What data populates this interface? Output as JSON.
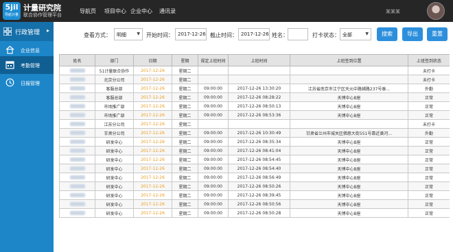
{
  "app": {
    "logo_text": "5jil",
    "logo_sub": "导航计量",
    "title": "计量研究院",
    "subtitle": "联合协作管理平台",
    "nav": [
      "导航页",
      "项目中心",
      "企业中心",
      "通讯录"
    ],
    "username": "某某某"
  },
  "sidebar": {
    "section_label": "行政管理",
    "items": [
      {
        "label": "企业信息",
        "icon": "home-icon",
        "active": false
      },
      {
        "label": "考勤管理",
        "icon": "calendar-icon",
        "active": true
      },
      {
        "label": "日报管理",
        "icon": "clock-icon",
        "active": false
      }
    ]
  },
  "filter": {
    "view_label": "查看方式：",
    "view_value": "明细",
    "start_label": "开始时间：",
    "start_value": "2017-12-26",
    "end_label": "截止时间：",
    "end_value": "2017-12-26",
    "name_label": "姓名：",
    "name_value": "",
    "status_label": "打卡状态：",
    "status_value": "全部",
    "search_btn": "搜索",
    "export_btn": "导出",
    "reset_btn": "重置"
  },
  "table": {
    "headers": [
      "姓名",
      "部门",
      "日期",
      "星期",
      "规定上班时间",
      "上班时间",
      "上班签到位置",
      "上班签到状态"
    ],
    "rows": [
      [
        "",
        "51计量联合协作",
        "2017-12-26",
        "星期二",
        "",
        "",
        "",
        "未打卡"
      ],
      [
        "",
        "北京分公司",
        "2017-12-26",
        "星期二",
        "",
        "",
        "",
        "未打卡"
      ],
      [
        "",
        "客服总部",
        "2017-12-26",
        "星期二",
        "09:00:00",
        "2017-12-26 13:30:20",
        "江苏省南京市江宁区天元中路辅路237号泰...",
        "外勤"
      ],
      [
        "",
        "客服总部",
        "2017-12-26",
        "星期二",
        "09:00:00",
        "2017-12-26 08:28:22",
        "天博中心B座",
        "正常"
      ],
      [
        "",
        "市场推广部",
        "2017-12-26",
        "星期二",
        "09:00:00",
        "2017-12-26 08:50:13",
        "天博中心B座",
        "正常"
      ],
      [
        "",
        "市场推广部",
        "2017-12-26",
        "星期二",
        "09:00:00",
        "2017-12-26 08:53:36",
        "天博中心B座",
        "正常"
      ],
      [
        "",
        "江苏分公司",
        "2017-12-26",
        "星期二",
        "",
        "",
        "",
        "未打卡"
      ],
      [
        "",
        "甘肃分公司",
        "2017-12-26",
        "星期二",
        "09:00:00",
        "2017-12-26 10:30:49",
        "甘肃省兰州市城关区佛慈大街551号靠近黄河...",
        "外勤"
      ],
      [
        "",
        "研发中心",
        "2017-12-26",
        "星期二",
        "09:00:00",
        "2017-12-26 08:35:34",
        "天博中心B座",
        "正常"
      ],
      [
        "",
        "研发中心",
        "2017-12-26",
        "星期二",
        "09:00:00",
        "2017-12-26 08:41:04",
        "天博中心B座",
        "正常"
      ],
      [
        "",
        "研发中心",
        "2017-12-26",
        "星期二",
        "09:00:00",
        "2017-12-26 08:54:45",
        "天博中心B座",
        "正常"
      ],
      [
        "",
        "研发中心",
        "2017-12-26",
        "星期二",
        "09:00:00",
        "2017-12-26 08:54:40",
        "天博中心B座",
        "正常"
      ],
      [
        "",
        "研发中心",
        "2017-12-26",
        "星期二",
        "09:00:00",
        "2017-12-26 08:56:49",
        "天博中心B座",
        "正常"
      ],
      [
        "",
        "研发中心",
        "2017-12-26",
        "星期二",
        "09:00:00",
        "2017-12-26 08:50:26",
        "天博中心B座",
        "正常"
      ],
      [
        "",
        "研发中心",
        "2017-12-26",
        "星期二",
        "09:00:00",
        "2017-12-26 08:39:45",
        "天博中心B座",
        "正常"
      ],
      [
        "",
        "研发中心",
        "2017-12-26",
        "星期二",
        "09:00:00",
        "2017-12-26 08:50:56",
        "天博中心B座",
        "正常"
      ],
      [
        "",
        "研发中心",
        "2017-12-26",
        "星期二",
        "09:00:00",
        "2017-12-26 08:50:28",
        "天博中心B座",
        "正常"
      ]
    ]
  },
  "colors": {
    "topbar": "#262626",
    "sidebar": "#1c86c9",
    "sidebar_active": "#0f5f93",
    "button": "#2d8fdc",
    "date_text": "#e89b20"
  }
}
